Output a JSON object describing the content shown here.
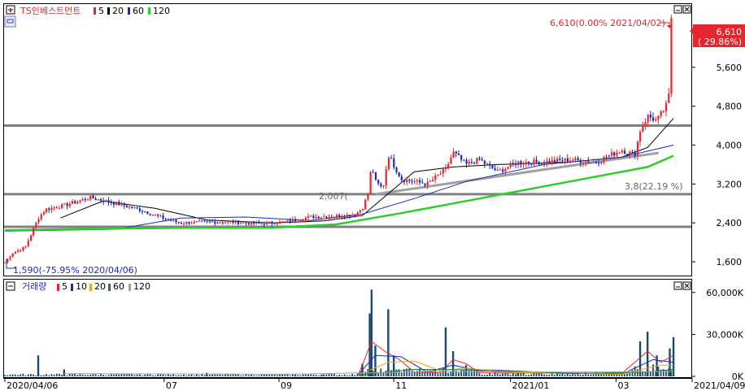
{
  "legend_price": {
    "title": "TS인베스트먼트",
    "items": [
      {
        "label": "5",
        "color": "#e6262e"
      },
      {
        "label": "20",
        "color": "#000000"
      },
      {
        "label": "60",
        "color": "#1c2bb5"
      },
      {
        "label": "120",
        "color": "#2ecc2e"
      }
    ]
  },
  "legend_volume": {
    "title": "거래량",
    "items": [
      {
        "label": "5",
        "color": "#e6262e"
      },
      {
        "label": "10",
        "color": "#1c2bb5"
      },
      {
        "label": "20",
        "color": "#e8a317"
      },
      {
        "label": "60",
        "color": "#1f7a3a"
      },
      {
        "label": "120",
        "color": "#a0a0a0"
      }
    ]
  },
  "annotations": {
    "high": "6,610(0.00% 2021/04/02)",
    "low": "1,590(-75.95% 2020/04/06)",
    "current_price": "6,610",
    "current_change": "( 29.86%)",
    "trend_a": "2,007(",
    "trend_b": "3,8(22.19 %)"
  },
  "colors": {
    "up": "#e6262e",
    "down": "#1c2bb5",
    "hline": "#808080",
    "trend": "#a0a0a0"
  },
  "chart_data": [
    {
      "type": "candlestick",
      "y_ticks": [
        "5,600",
        "4,800",
        "4,000",
        "3,200",
        "2,400",
        "1,600"
      ],
      "y_tick_values": [
        5600,
        4800,
        4000,
        3200,
        2400,
        1600
      ],
      "ylim": [
        1300,
        6900
      ],
      "x_range": [
        "2020/04/06",
        "2021/04/09"
      ],
      "horizontal_lines": [
        4400,
        2990,
        2320
      ],
      "trend_line": {
        "from": [
          "2020/10/23",
          2990
        ],
        "to": [
          "2021/03/25",
          3840
        ]
      },
      "close_points": [
        [
          "2020/04/06",
          1590
        ],
        [
          "2020/04/10",
          1780
        ],
        [
          "2020/04/17",
          1900
        ],
        [
          "2020/04/24",
          2500
        ],
        [
          "2020/04/28",
          2680
        ],
        [
          "2020/05/08",
          2760
        ],
        [
          "2020/05/22",
          2920
        ],
        [
          "2020/06/05",
          2800
        ],
        [
          "2020/06/19",
          2660
        ],
        [
          "2020/06/26",
          2560
        ],
        [
          "2020/07/03",
          2460
        ],
        [
          "2020/07/10",
          2400
        ],
        [
          "2020/07/24",
          2420
        ],
        [
          "2020/08/07",
          2420
        ],
        [
          "2020/08/21",
          2380
        ],
        [
          "2020/09/04",
          2420
        ],
        [
          "2020/09/18",
          2520
        ],
        [
          "2020/10/02",
          2540
        ],
        [
          "2020/10/12",
          2570
        ],
        [
          "2020/10/16",
          2700
        ],
        [
          "2020/10/19",
          3000
        ],
        [
          "2020/10/21",
          3600
        ],
        [
          "2020/10/23",
          3250
        ],
        [
          "2020/10/27",
          3100
        ],
        [
          "2020/10/30",
          3800
        ],
        [
          "2020/11/06",
          3300
        ],
        [
          "2020/11/20",
          3200
        ],
        [
          "2020/11/30",
          3500
        ],
        [
          "2020/12/04",
          3850
        ],
        [
          "2020/12/11",
          3600
        ],
        [
          "2020/12/18",
          3700
        ],
        [
          "2020/12/28",
          3450
        ],
        [
          "2021/01/08",
          3650
        ],
        [
          "2021/01/22",
          3650
        ],
        [
          "2021/02/05",
          3700
        ],
        [
          "2021/02/19",
          3650
        ],
        [
          "2021/03/05",
          3900
        ],
        [
          "2021/03/12",
          3800
        ],
        [
          "2021/03/15",
          4300
        ],
        [
          "2021/03/19",
          4600
        ],
        [
          "2021/03/24",
          4500
        ],
        [
          "2021/03/29",
          4800
        ],
        [
          "2021/03/31",
          5100
        ],
        [
          "2021/04/02",
          6610
        ]
      ],
      "ma": [
        {
          "name": "20",
          "color": "#000000",
          "points": [
            [
              "2020/05/06",
              2500
            ],
            [
              "2020/05/29",
              2850
            ],
            [
              "2020/06/26",
              2700
            ],
            [
              "2020/07/24",
              2460
            ],
            [
              "2020/08/28",
              2400
            ],
            [
              "2020/09/25",
              2440
            ],
            [
              "2020/10/16",
              2550
            ],
            [
              "2020/10/30",
              3000
            ],
            [
              "2020/11/13",
              3450
            ],
            [
              "2020/12/04",
              3550
            ],
            [
              "2020/12/28",
              3600
            ],
            [
              "2021/02/05",
              3650
            ],
            [
              "2021/03/05",
              3750
            ],
            [
              "2021/03/19",
              3950
            ],
            [
              "2021/04/02",
              4550
            ]
          ]
        },
        {
          "name": "60",
          "color": "#1c2bb5",
          "points": [
            [
              "2020/04/06",
              2230
            ],
            [
              "2020/06/05",
              2270
            ],
            [
              "2020/07/10",
              2500
            ],
            [
              "2020/08/14",
              2520
            ],
            [
              "2020/09/18",
              2450
            ],
            [
              "2020/10/16",
              2580
            ],
            [
              "2020/11/13",
              2900
            ],
            [
              "2020/12/11",
              3250
            ],
            [
              "2021/01/22",
              3600
            ],
            [
              "2021/03/05",
              3750
            ],
            [
              "2021/04/02",
              4000
            ]
          ]
        },
        {
          "name": "120",
          "color": "#2ecc2e",
          "points": [
            [
              "2020/04/06",
              2250
            ],
            [
              "2020/05/08",
              2270
            ],
            [
              "2020/07/10",
              2300
            ],
            [
              "2020/08/28",
              2300
            ],
            [
              "2020/10/02",
              2370
            ],
            [
              "2020/11/06",
              2600
            ],
            [
              "2020/12/18",
              2900
            ],
            [
              "2021/02/05",
              3250
            ],
            [
              "2021/03/19",
              3550
            ],
            [
              "2021/04/02",
              3780
            ]
          ]
        }
      ]
    },
    {
      "type": "bar",
      "name": "거래량",
      "y_ticks": [
        "60,000K",
        "30,000K",
        "0K"
      ],
      "y_tick_values": [
        60000,
        30000,
        0
      ],
      "ylim": [
        0,
        68000
      ],
      "x_ticks": [
        {
          "date": "2020/04/06",
          "label": "2020/04/06"
        },
        {
          "date": "2020/07/01",
          "label": "07"
        },
        {
          "date": "2020/09/01",
          "label": "09"
        },
        {
          "date": "2020/11/02",
          "label": "11"
        },
        {
          "date": "2021/01/04",
          "label": "2021/01"
        },
        {
          "date": "2021/03/02",
          "label": "03"
        },
        {
          "date": "2021/04/09",
          "label": "2021/04/09"
        }
      ],
      "spikes": [
        [
          "2020/04/24",
          15000
        ],
        [
          "2020/05/08",
          5000
        ],
        [
          "2020/07/24",
          2500
        ],
        [
          "2020/09/25",
          1500
        ],
        [
          "2020/10/16",
          9000
        ],
        [
          "2020/10/20",
          45000
        ],
        [
          "2020/10/21",
          62000
        ],
        [
          "2020/10/23",
          22000
        ],
        [
          "2020/10/30",
          48000
        ],
        [
          "2020/11/02",
          15000
        ],
        [
          "2020/11/30",
          35000
        ],
        [
          "2020/12/04",
          18000
        ],
        [
          "2020/12/11",
          8000
        ],
        [
          "2021/01/08",
          3000
        ],
        [
          "2021/03/15",
          25000
        ],
        [
          "2021/03/19",
          32000
        ],
        [
          "2021/03/24",
          15000
        ],
        [
          "2021/03/31",
          20000
        ],
        [
          "2021/04/02",
          28000
        ]
      ],
      "ma": [
        {
          "name": "5",
          "color": "#e6262e",
          "points": [
            [
              "2020/10/14",
              1500
            ],
            [
              "2020/10/21",
              25000
            ],
            [
              "2020/10/28",
              18000
            ],
            [
              "2020/11/05",
              12000
            ],
            [
              "2020/11/13",
              3000
            ],
            [
              "2020/11/27",
              2500
            ],
            [
              "2020/12/04",
              12000
            ],
            [
              "2020/12/11",
              9000
            ],
            [
              "2020/12/18",
              2500
            ],
            [
              "2021/03/05",
              2000
            ],
            [
              "2021/03/19",
              18000
            ],
            [
              "2021/03/26",
              10000
            ],
            [
              "2021/04/02",
              15000
            ]
          ]
        },
        {
          "name": "10",
          "color": "#1c2bb5",
          "points": [
            [
              "2020/10/14",
              1500
            ],
            [
              "2020/10/23",
              15000
            ],
            [
              "2020/11/06",
              14000
            ],
            [
              "2020/11/20",
              3000
            ],
            [
              "2020/12/04",
              8000
            ],
            [
              "2020/12/18",
              4000
            ],
            [
              "2021/03/05",
              1500
            ],
            [
              "2021/03/22",
              12000
            ],
            [
              "2021/04/02",
              10000
            ]
          ]
        },
        {
          "name": "20",
          "color": "#e8a317",
          "points": [
            [
              "2020/10/14",
              1200
            ],
            [
              "2020/10/30",
              10000
            ],
            [
              "2020/11/13",
              11000
            ],
            [
              "2020/11/27",
              4000
            ],
            [
              "2020/12/11",
              6000
            ],
            [
              "2020/12/28",
              3000
            ],
            [
              "2021/03/05",
              1500
            ],
            [
              "2021/03/26",
              8000
            ],
            [
              "2021/04/02",
              8000
            ]
          ]
        },
        {
          "name": "60",
          "color": "#1f7a3a",
          "points": [
            [
              "2020/10/14",
              1000
            ],
            [
              "2020/11/13",
              5000
            ],
            [
              "2020/12/28",
              4500
            ],
            [
              "2021/02/05",
              2000
            ],
            [
              "2021/03/19",
              3000
            ],
            [
              "2021/04/02",
              5000
            ]
          ]
        },
        {
          "name": "120",
          "color": "#a0a0a0",
          "points": [
            [
              "2020/05/08",
              2000
            ],
            [
              "2020/09/04",
              1500
            ],
            [
              "2020/11/27",
              3500
            ],
            [
              "2021/02/05",
              3000
            ],
            [
              "2021/04/02",
              3500
            ]
          ]
        }
      ]
    }
  ]
}
